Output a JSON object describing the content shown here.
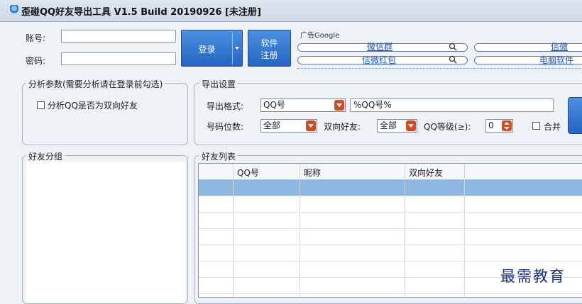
{
  "window": {
    "title": "歪碰QQ好友导出工具 V1.5  Build  20190926   [未注册]"
  },
  "login": {
    "account_label": "账号:",
    "password_label": "密码:",
    "account_value": "",
    "password_value": "",
    "login_button": "登录",
    "register_button_line1": "软件",
    "register_button_line2": "注册"
  },
  "ad": {
    "label": "广告Google",
    "links": [
      "微信群",
      "信微",
      "信微红包",
      "电脑软件"
    ]
  },
  "analysis": {
    "title": "分析参数(需要分析请在登录前勾选)",
    "check_bidirectional": "分析QQ是否为双向好友"
  },
  "export_settings": {
    "title": "导出设置",
    "format_label": "导出格式:",
    "format_value": "QQ号",
    "format_template": "%QQ号%",
    "digits_label": "号码位数:",
    "digits_value": "全部",
    "bidirectional_label": "双向好友:",
    "bidirectional_value": "全部",
    "level_label": "QQ等级(≥):",
    "level_value": "0",
    "merge_label": "合并"
  },
  "friend_groups": {
    "title": "好友分组"
  },
  "friend_list": {
    "title": "好友列表",
    "columns": [
      "QQ号",
      "昵称",
      "双向好友"
    ]
  },
  "watermark": "最需教育"
}
